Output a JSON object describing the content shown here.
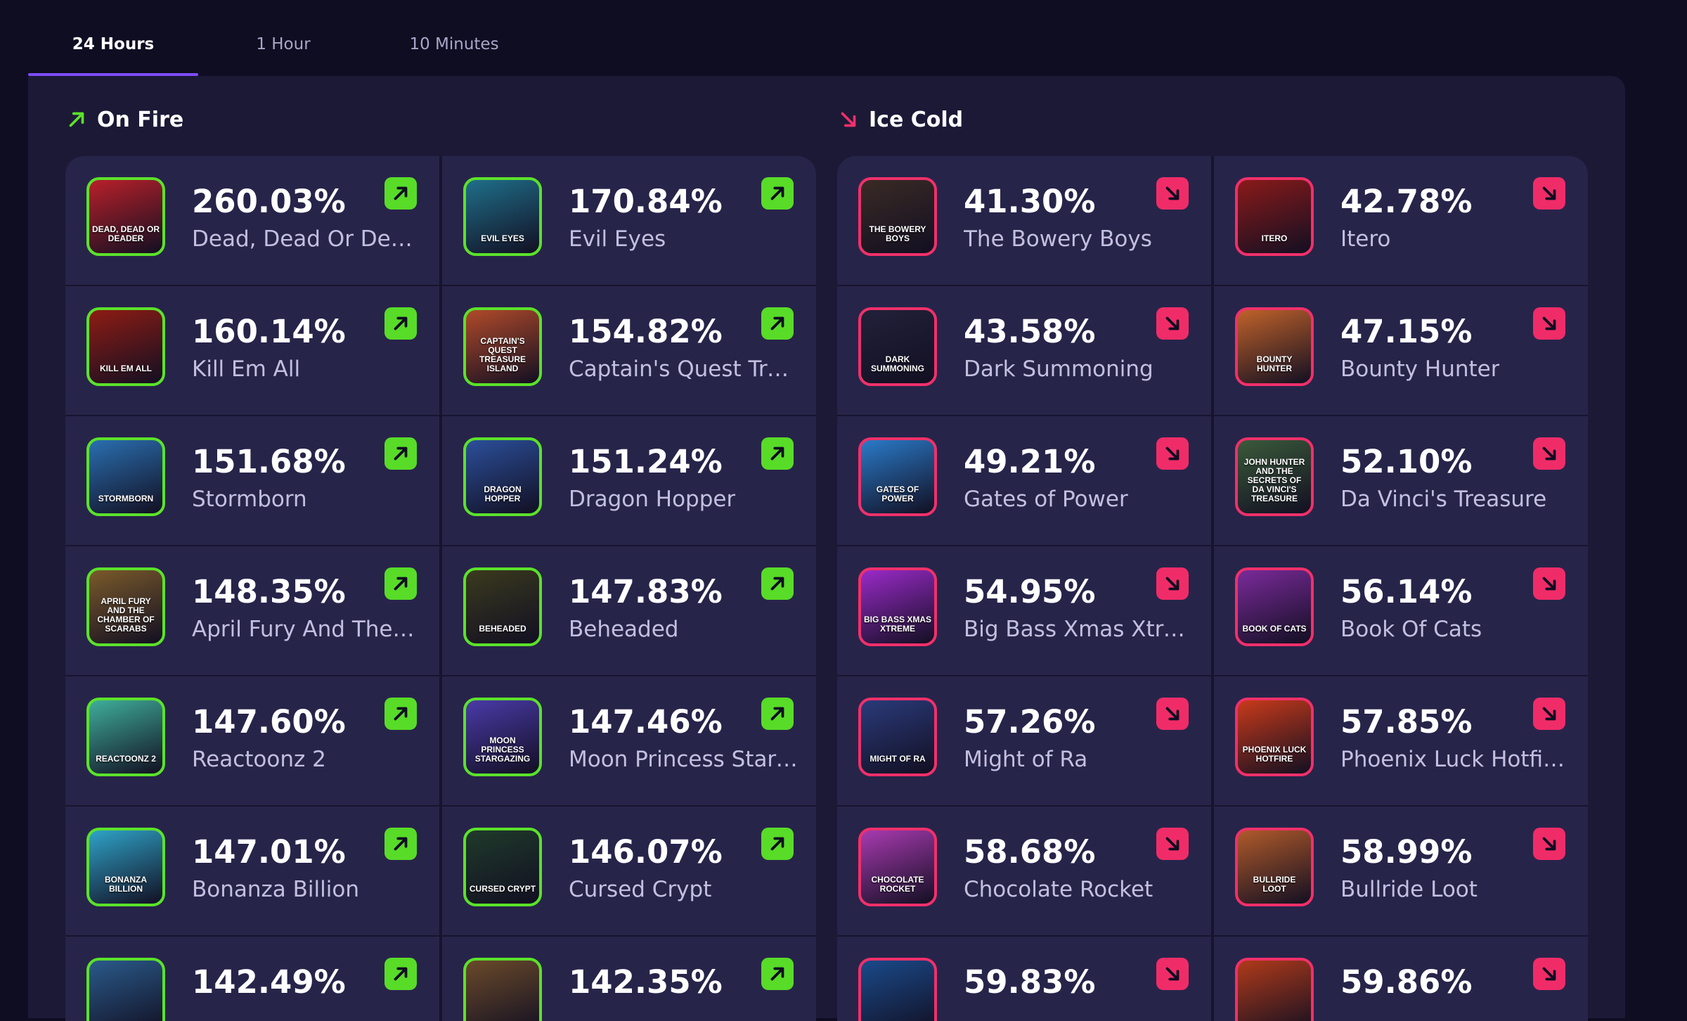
{
  "tabs": [
    {
      "label": "24 Hours",
      "active": true
    },
    {
      "label": "1 Hour",
      "active": false
    },
    {
      "label": "10 Minutes",
      "active": false
    }
  ],
  "colors": {
    "background": "#0f0d21",
    "panel": "#1c1937",
    "card": "#27244a",
    "hot_accent": "#5be22a",
    "cold_accent": "#f0306a",
    "tab_underline": "#7c4dff"
  },
  "on_fire": {
    "title": "On Fire",
    "icon": "arrow-up-right-icon",
    "items": [
      {
        "pct": "260.03%",
        "name": "Dead, Dead Or Dead...",
        "thumb_text": "Dead, Dead or Deader",
        "thumb_color": "#b8202a"
      },
      {
        "pct": "170.84%",
        "name": "Evil Eyes",
        "thumb_text": "Evil Eyes",
        "thumb_color": "#1f6f8a"
      },
      {
        "pct": "160.14%",
        "name": "Kill Em All",
        "thumb_text": "Kill Em All",
        "thumb_color": "#8e1c14"
      },
      {
        "pct": "154.82%",
        "name": "Captain's Quest Trea...",
        "thumb_text": "Captain's Quest Treasure Island",
        "thumb_color": "#b04a2a"
      },
      {
        "pct": "151.68%",
        "name": "Stormborn",
        "thumb_text": "Stormborn",
        "thumb_color": "#2a6fb0"
      },
      {
        "pct": "151.24%",
        "name": "Dragon Hopper",
        "thumb_text": "Dragon Hopper",
        "thumb_color": "#2b4f9a"
      },
      {
        "pct": "148.35%",
        "name": "April Fury And The C...",
        "thumb_text": "April Fury and the Chamber of Scarabs",
        "thumb_color": "#7a5a2a"
      },
      {
        "pct": "147.83%",
        "name": "Beheaded",
        "thumb_text": "Beheaded",
        "thumb_color": "#3a3a1e"
      },
      {
        "pct": "147.60%",
        "name": "Reactoonz 2",
        "thumb_text": "Reactoonz 2",
        "thumb_color": "#3fae9a"
      },
      {
        "pct": "147.46%",
        "name": "Moon Princess Starg...",
        "thumb_text": "Moon Princess Stargazing",
        "thumb_color": "#4a3aa8"
      },
      {
        "pct": "147.01%",
        "name": "Bonanza Billion",
        "thumb_text": "Bonanza Billion",
        "thumb_color": "#2fa3c8"
      },
      {
        "pct": "146.07%",
        "name": "Cursed Crypt",
        "thumb_text": "Cursed Crypt",
        "thumb_color": "#1f3a2a"
      },
      {
        "pct": "142.49%",
        "name": "",
        "thumb_text": "",
        "thumb_color": "#2a5a8a"
      },
      {
        "pct": "142.35%",
        "name": "",
        "thumb_text": "",
        "thumb_color": "#6a4a2a"
      }
    ]
  },
  "ice_cold": {
    "title": "Ice Cold",
    "icon": "arrow-down-right-icon",
    "items": [
      {
        "pct": "41.30%",
        "name": "The Bowery Boys",
        "thumb_text": "The Bowery Boys",
        "thumb_color": "#3a2a24"
      },
      {
        "pct": "42.78%",
        "name": "Itero",
        "thumb_text": "Itero",
        "thumb_color": "#8a1a1a"
      },
      {
        "pct": "43.58%",
        "name": "Dark Summoning",
        "thumb_text": "Dark Summoning",
        "thumb_color": "#22213a"
      },
      {
        "pct": "47.15%",
        "name": "Bounty Hunter",
        "thumb_text": "Bounty Hunter",
        "thumb_color": "#c0622a"
      },
      {
        "pct": "49.21%",
        "name": "Gates of Power",
        "thumb_text": "Gates of Power",
        "thumb_color": "#2a7ac8"
      },
      {
        "pct": "52.10%",
        "name": "Da Vinci's Treasure",
        "thumb_text": "John Hunter and the Secrets of Da Vinci's Treasure",
        "thumb_color": "#3a5a3a"
      },
      {
        "pct": "54.95%",
        "name": "Big Bass Xmas Xtreme",
        "thumb_text": "Big Bass Xmas Xtreme",
        "thumb_color": "#9a2ac8"
      },
      {
        "pct": "56.14%",
        "name": "Book Of Cats",
        "thumb_text": "Book of Cats",
        "thumb_color": "#7a2a9a"
      },
      {
        "pct": "57.26%",
        "name": "Might of Ra",
        "thumb_text": "Might of Ra",
        "thumb_color": "#2a3a7a"
      },
      {
        "pct": "57.85%",
        "name": "Phoenix Luck Hotfire...",
        "thumb_text": "Phoenix Luck Hotfire",
        "thumb_color": "#c83a1a"
      },
      {
        "pct": "58.68%",
        "name": "Chocolate Rocket",
        "thumb_text": "Chocolate Rocket",
        "thumb_color": "#a83ab0"
      },
      {
        "pct": "58.99%",
        "name": "Bullride Loot",
        "thumb_text": "Bullride Loot",
        "thumb_color": "#b05a2a"
      },
      {
        "pct": "59.83%",
        "name": "",
        "thumb_text": "",
        "thumb_color": "#1a4a8a"
      },
      {
        "pct": "59.86%",
        "name": "",
        "thumb_text": "",
        "thumb_color": "#b03a1a"
      }
    ]
  }
}
